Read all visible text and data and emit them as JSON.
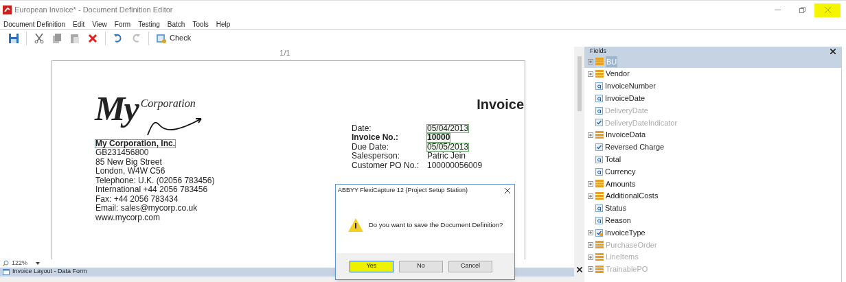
{
  "window": {
    "title": "European Invoice* - Document Definition Editor",
    "close_marked": true
  },
  "menu": [
    "Document Definition",
    "Edit",
    "View",
    "Form",
    "Testing",
    "Batch",
    "Tools",
    "Help"
  ],
  "toolbar": [
    {
      "kind": "save"
    },
    {
      "kind": "sep"
    },
    {
      "kind": "cut"
    },
    {
      "kind": "copy"
    },
    {
      "kind": "paste"
    },
    {
      "kind": "delete"
    },
    {
      "kind": "sep"
    },
    {
      "kind": "undo"
    },
    {
      "kind": "redo"
    },
    {
      "kind": "sep"
    },
    {
      "kind": "check",
      "label": "Check"
    }
  ],
  "document": {
    "page_counter": "1/1",
    "logo": {
      "big": "My",
      "small": "Corporation"
    },
    "company_lines": [
      {
        "text": "My Corporation, Inc.",
        "bold": true,
        "boxed": true
      },
      {
        "text": "GB231456800",
        "bold": false,
        "boxed": false
      },
      {
        "text": "85 New Big Street",
        "bold": false,
        "boxed": false
      },
      {
        "text": "London, W4W C56",
        "bold": false,
        "boxed": false
      },
      {
        "text": "Telephone: U.K. (02056 783456)",
        "bold": false,
        "boxed": false
      },
      {
        "text": "International +44 2056 783456",
        "bold": false,
        "boxed": false
      },
      {
        "text": "Fax: +44 2056 783434",
        "bold": false,
        "boxed": false
      },
      {
        "text": "Email: sales@mycorp.co.uk",
        "bold": false,
        "boxed": false
      },
      {
        "text": "www.mycorp.com",
        "bold": false,
        "boxed": false
      }
    ],
    "heading": "Invoice",
    "details": [
      {
        "label": "Date:",
        "value": "05/04/2013",
        "bold": false,
        "boxed": true
      },
      {
        "label": "Invoice No.:",
        "value": "10000",
        "bold": true,
        "boxed": true
      },
      {
        "label": "Due Date:",
        "value": "05/05/2013",
        "bold": false,
        "boxed": true
      },
      {
        "label": "Salesperson:",
        "value": "Patric Jein",
        "bold": false,
        "boxed": false
      },
      {
        "label": "Customer PO No.:",
        "value": "100000056009",
        "bold": false,
        "boxed": false
      }
    ]
  },
  "zoom": {
    "value": "122%"
  },
  "bottom_panel": {
    "title": "Invoice Layout - Data Form"
  },
  "fields_panel": {
    "title": "Fields",
    "items": [
      {
        "kind": "group",
        "label": "BU",
        "expandable": true,
        "disabled": false,
        "selected": true
      },
      {
        "kind": "group",
        "label": "Vendor",
        "expandable": true,
        "disabled": false,
        "selected": false
      },
      {
        "kind": "text",
        "label": "InvoiceNumber",
        "expandable": false,
        "disabled": false,
        "selected": false
      },
      {
        "kind": "text",
        "label": "InvoiceDate",
        "expandable": false,
        "disabled": false,
        "selected": false
      },
      {
        "kind": "text",
        "label": "DeliveryDate",
        "expandable": false,
        "disabled": true,
        "selected": false
      },
      {
        "kind": "checkbox",
        "label": "DeliveryDateIndicator",
        "expandable": false,
        "disabled": true,
        "selected": false
      },
      {
        "kind": "group",
        "label": "InvoiceData",
        "expandable": true,
        "disabled": false,
        "selected": false
      },
      {
        "kind": "checkbox",
        "label": "Reversed Charge",
        "expandable": false,
        "disabled": false,
        "selected": false
      },
      {
        "kind": "text",
        "label": "Total",
        "expandable": false,
        "disabled": false,
        "selected": false
      },
      {
        "kind": "text",
        "label": "Currency",
        "expandable": false,
        "disabled": false,
        "selected": false
      },
      {
        "kind": "group",
        "label": "Amounts",
        "expandable": true,
        "disabled": false,
        "selected": false
      },
      {
        "kind": "group",
        "label": "AdditionalCosts",
        "expandable": true,
        "disabled": false,
        "selected": false
      },
      {
        "kind": "text",
        "label": "Status",
        "expandable": false,
        "disabled": false,
        "selected": false
      },
      {
        "kind": "text",
        "label": "Reason",
        "expandable": false,
        "disabled": false,
        "selected": false
      },
      {
        "kind": "list",
        "label": "InvoiceType",
        "expandable": true,
        "disabled": false,
        "selected": false
      },
      {
        "kind": "group",
        "label": "PurchaseOrder",
        "expandable": true,
        "disabled": true,
        "selected": false
      },
      {
        "kind": "group",
        "label": "LineItems",
        "expandable": true,
        "disabled": true,
        "selected": false
      },
      {
        "kind": "group",
        "label": "TrainablePO",
        "expandable": true,
        "disabled": true,
        "selected": false
      }
    ]
  },
  "dialog": {
    "title": "ABBYY FlexiCapture 12 (Project Setup Station)",
    "message": "Do you want to save the Document Definition?",
    "buttons": [
      {
        "label": "Yes",
        "focused": true,
        "marked": true
      },
      {
        "label": "No",
        "focused": false,
        "marked": false
      },
      {
        "label": "Cancel",
        "focused": false,
        "marked": false
      }
    ]
  }
}
